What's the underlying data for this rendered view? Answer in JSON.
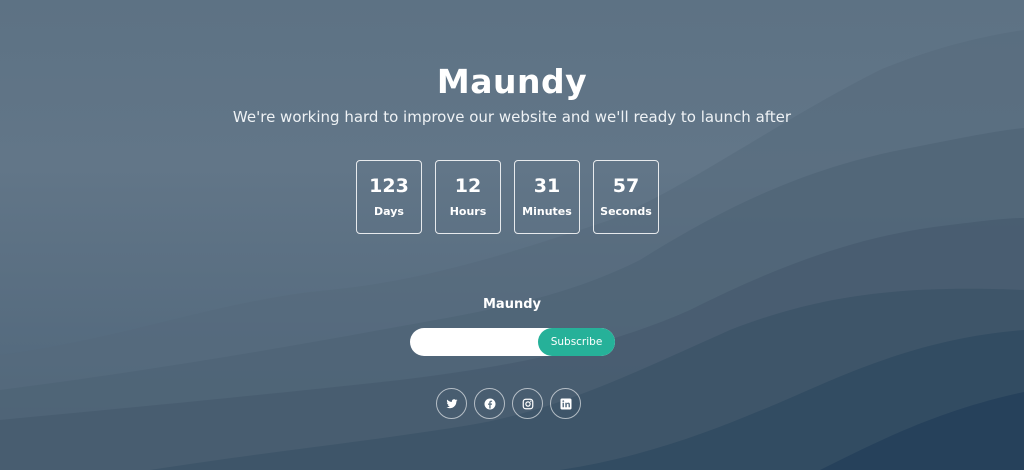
{
  "header": {
    "title": "Maundy",
    "subtitle": "We're working hard to improve our website and we'll ready to launch after"
  },
  "countdown": [
    {
      "value": "123",
      "label": "Days"
    },
    {
      "value": "12",
      "label": "Hours"
    },
    {
      "value": "31",
      "label": "Minutes"
    },
    {
      "value": "57",
      "label": "Seconds"
    }
  ],
  "subscribe": {
    "title": "Maundy",
    "input_value": "",
    "button_label": "Subscribe"
  },
  "socials": [
    {
      "icon": "twitter-icon"
    },
    {
      "icon": "facebook-icon"
    },
    {
      "icon": "instagram-icon"
    },
    {
      "icon": "linkedin-icon"
    }
  ],
  "colors": {
    "accent": "#26b199",
    "background": "#5d7284",
    "text": "#ffffff"
  }
}
